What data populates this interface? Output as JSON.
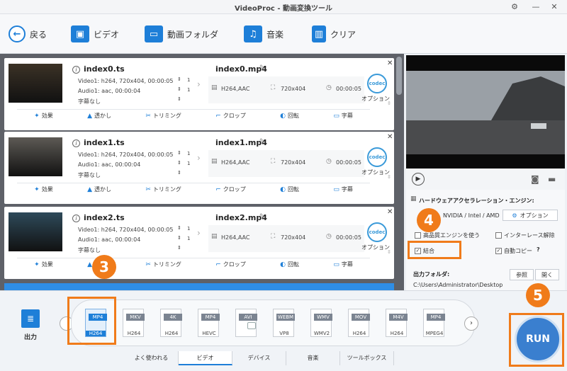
{
  "window": {
    "title": "VideoProc - 動画変換ツール",
    "settings_icon": "gear-icon",
    "minimize": "—",
    "close": "✕"
  },
  "toolbar": {
    "back": "戻る",
    "video": "ビデオ",
    "folder": "動画フォルダ",
    "music": "音楽",
    "clear": "クリア"
  },
  "files": [
    {
      "input_name": "index0.ts",
      "video_info": "Video1: h264, 720x404, 00:00:05",
      "audio_info": "Audio1: aac, 00:00:04",
      "subtitle_info": "字幕なし",
      "video_count": "1",
      "audio_count": "1",
      "output_name": "index0.mp4",
      "codec": "H264,AAC",
      "resolution": "720x404",
      "duration": "00:00:05",
      "thumb_color": "#3b3226"
    },
    {
      "input_name": "index1.ts",
      "video_info": "Video1: h264, 720x404, 00:00:05",
      "audio_info": "Audio1: aac, 00:00:04",
      "subtitle_info": "字幕なし",
      "video_count": "1",
      "audio_count": "1",
      "output_name": "index1.mp4",
      "codec": "H264,AAC",
      "resolution": "720x404",
      "duration": "00:00:05",
      "thumb_color": "#5d5a55"
    },
    {
      "input_name": "index2.ts",
      "video_info": "Video1: h264, 720x404, 00:00:05",
      "audio_info": "Audio1: aac, 00:00:04",
      "subtitle_info": "字幕なし",
      "video_count": "1",
      "audio_count": "1",
      "output_name": "index2.mp4",
      "codec": "H264,AAC",
      "resolution": "720x404",
      "duration": "00:00:05",
      "thumb_color": "#2e4a5a"
    }
  ],
  "card_labels": {
    "codec_badge": "codec",
    "option": "オプション"
  },
  "card_actions": [
    "効果",
    "透かし",
    "トリミング",
    "クロップ",
    "回転",
    "字幕"
  ],
  "settings": {
    "hw_title": "ハードウェアアクセラレーション・エンジン:",
    "hw_vendor": "NVIDIA / Intel / AMD",
    "option_button": "オプション",
    "high_quality": "高品質エンジンを使う",
    "deinterlace": "インターレース解除",
    "merge": "結合",
    "auto_copy": "自動コピー",
    "auto_copy_help": "?",
    "output_folder_label": "出力フォルダ:",
    "browse": "参照",
    "open": "開く",
    "output_path": "C:\\Users\\Administrator\\Desktop"
  },
  "bottom": {
    "output_label": "出力",
    "formats": [
      {
        "tag": "MP4",
        "sub": "H264",
        "selected": true
      },
      {
        "tag": "MKV",
        "sub": "H264"
      },
      {
        "tag": "4K",
        "sub": "H264"
      },
      {
        "tag": "MP4",
        "sub": "HEVC"
      },
      {
        "tag": "AVI",
        "sub": ""
      },
      {
        "tag": "WEBM",
        "sub": "VP8"
      },
      {
        "tag": "WMV",
        "sub": "WMV2"
      },
      {
        "tag": "MOV",
        "sub": "H264"
      },
      {
        "tag": "M4V",
        "sub": "H264"
      },
      {
        "tag": "MP4",
        "sub": "MPEG4"
      }
    ],
    "tabs": [
      "よく使われる",
      "ビデオ",
      "デバイス",
      "音楽",
      "ツールボックス"
    ],
    "run": "RUN"
  },
  "badges": {
    "b3": "3",
    "b4": "4",
    "b5": "5"
  },
  "colors": {
    "accent": "#1e7fd8",
    "badge": "#f07b1a"
  }
}
